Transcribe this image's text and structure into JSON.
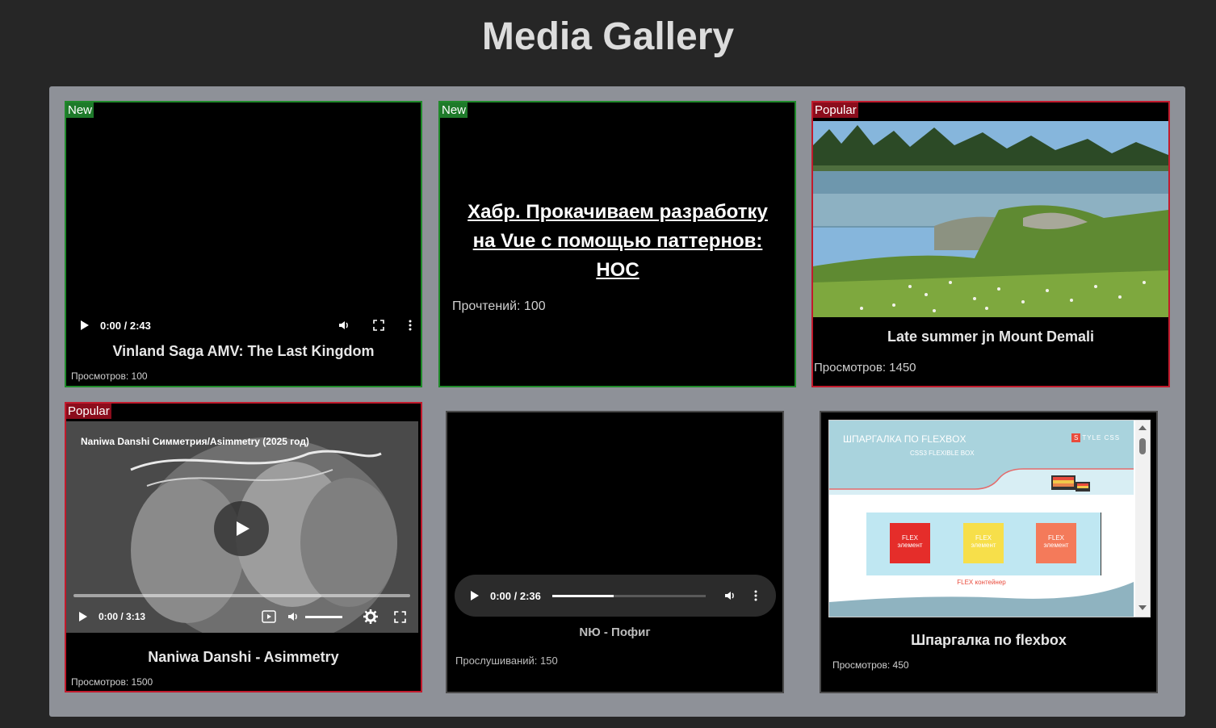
{
  "page": {
    "title": "Media Gallery"
  },
  "cards": [
    {
      "badge": "New",
      "type": "video",
      "time": "0:00 / 2:43",
      "title": "Vinland Saga AMV: The Last Kingdom",
      "stat": "Просмотров: 100"
    },
    {
      "badge": "New",
      "type": "article",
      "link": "Хабр. Прокачиваем разработку на Vue с помощью паттернов: HOC",
      "stat": "Прочтений: 100"
    },
    {
      "badge": "Popular",
      "type": "image",
      "title": "Late summer jn Mount Demali",
      "stat": "Просмотров: 1450"
    },
    {
      "badge": "Popular",
      "type": "youtube",
      "embed_title": "Naniwa Danshi Симметрия/Asimmetry (2025 год)",
      "time": "0:00 / 3:13",
      "title": "Naniwa Danshi - Asimmetry",
      "stat": "Просмотров: 1500"
    },
    {
      "badge": "",
      "type": "audio",
      "time": "0:00 / 2:36",
      "progress": 0.4,
      "title": "NЮ - Пофиг",
      "stat": "Прослушиваний: 150"
    },
    {
      "badge": "",
      "type": "iframe",
      "embed": {
        "header": "ШПАРГАЛКА ПО FLEXBOX",
        "subheader": "CSS3 FLEXIBLE BOX",
        "brand_letter": "S",
        "brand_text": "TYLE CSS",
        "item_label_1": "FLEX",
        "item_label_2": "элемент",
        "container_label": "FLEX контейнер"
      },
      "title": "Шпаргалка по flexbox",
      "stat": "Просмотров: 450"
    }
  ],
  "colors": {
    "badge_new": "#1e7a2a",
    "badge_popular": "#8b0d1c",
    "border_new": "#1f8a2a",
    "border_popular": "#c21a2c"
  }
}
